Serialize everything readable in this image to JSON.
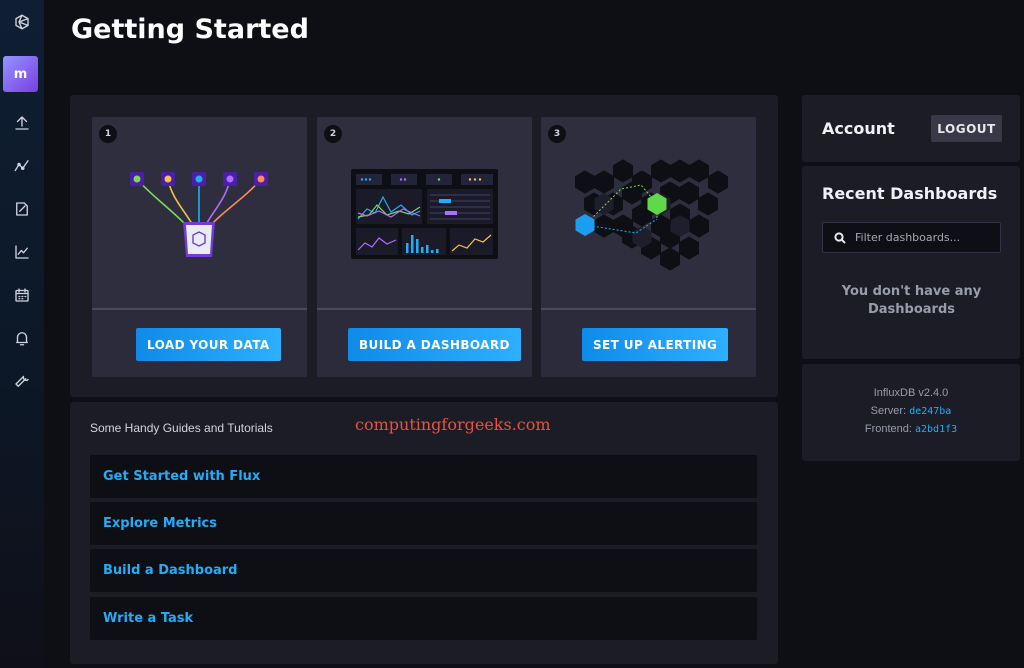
{
  "header": {
    "title": "Getting Started"
  },
  "sidebar": {
    "org_initial": "m",
    "icons": [
      "influx-logo-icon",
      "upload-icon",
      "data-explorer-icon",
      "notebook-icon",
      "chart-icon",
      "calendar-icon",
      "bell-icon",
      "wrench-icon"
    ]
  },
  "steps": [
    {
      "number": "1",
      "button": "LOAD YOUR DATA",
      "illustration": "data-sources-bucket"
    },
    {
      "number": "2",
      "button": "BUILD A DASHBOARD",
      "illustration": "dashboard-preview"
    },
    {
      "number": "3",
      "button": "SET UP ALERTING",
      "illustration": "hexagon-alert-grid"
    }
  ],
  "guides": {
    "heading": "Some Handy Guides and Tutorials",
    "watermark": "computingforgeeks.com",
    "links": [
      "Get Started with Flux",
      "Explore Metrics",
      "Build a Dashboard",
      "Write a Task"
    ]
  },
  "account": {
    "title": "Account",
    "logout_label": "LOGOUT"
  },
  "recent": {
    "title": "Recent Dashboards",
    "filter_placeholder": "Filter dashboards...",
    "empty_message": "You don't have any Dashboards"
  },
  "version": {
    "product": "InfluxDB v2.4.0",
    "server_label": "Server:",
    "server_hash": "de247ba",
    "frontend_label": "Frontend:",
    "frontend_hash": "a2bd1f3"
  },
  "colors": {
    "accent": "#22adf6",
    "button_start": "#0f8be8",
    "button_end": "#2eafff",
    "panel": "#1c1c27",
    "background": "#0e0e15"
  }
}
